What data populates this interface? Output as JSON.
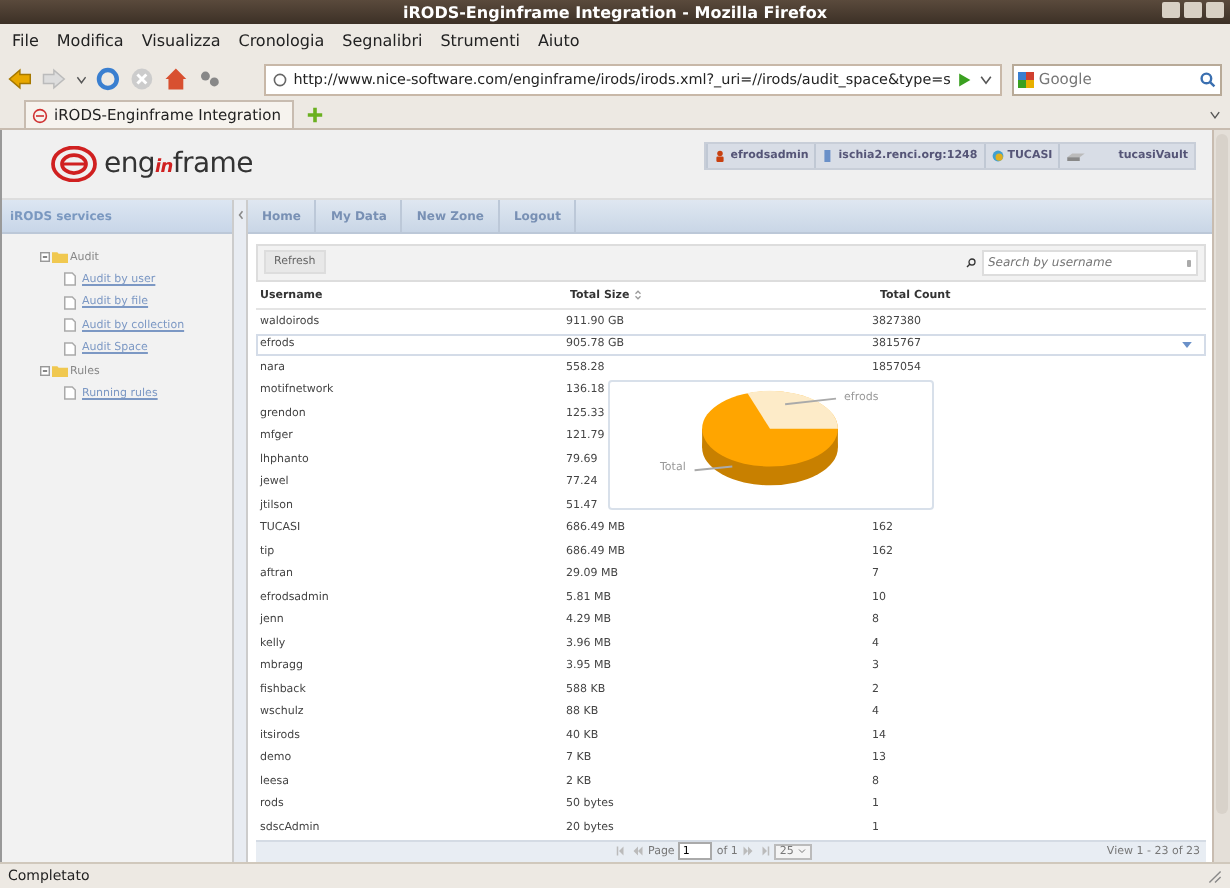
{
  "window": {
    "title": "iRODS-Enginframe Integration - Mozilla Firefox"
  },
  "menu": [
    "File",
    "Modifica",
    "Visualizza",
    "Cronologia",
    "Segnalibri",
    "Strumenti",
    "Aiuto"
  ],
  "address": "http://www.nice-software.com/enginframe/irods/irods.xml?_uri=//irods/audit_space&type=s",
  "search": {
    "placeholder": "Google"
  },
  "browser_tab": {
    "title": "iRODS-Enginframe Integration"
  },
  "logo": {
    "before": "eng",
    "accent": "in",
    "after": "frame"
  },
  "user_badges": [
    {
      "kind": "user",
      "label": "efrodsadmin"
    },
    {
      "kind": "server",
      "label": "ischia2.renci.org:1248"
    },
    {
      "kind": "zone",
      "label": "TUCASI"
    },
    {
      "kind": "vault",
      "label": "tucasiVault"
    }
  ],
  "sidebar": {
    "title": "iRODS services",
    "tree": [
      {
        "label": "Audit",
        "expanded": true,
        "children": [
          {
            "label": "Audit by user"
          },
          {
            "label": "Audit by file"
          },
          {
            "label": "Audit by collection"
          },
          {
            "label": "Audit Space"
          }
        ]
      },
      {
        "label": "Rules",
        "expanded": true,
        "children": [
          {
            "label": "Running rules"
          }
        ]
      }
    ]
  },
  "nav": [
    "Home",
    "My Data",
    "New Zone",
    "Logout"
  ],
  "grid": {
    "refresh": "Refresh",
    "search_placeholder": "Search by username",
    "columns": [
      {
        "label": "Username",
        "sorted": false
      },
      {
        "label": "Total Size",
        "sorted": true
      },
      {
        "label": "Total Count",
        "sorted": false
      }
    ],
    "rows": [
      {
        "username": "waldoirods",
        "size": "911.90 GB",
        "count": "3827380",
        "selected": false
      },
      {
        "username": "efrods",
        "size": "905.78 GB",
        "count": "3815767",
        "selected": true
      },
      {
        "username": "nara",
        "size": "558.28",
        "count": "1857054",
        "selected": false
      },
      {
        "username": "motifnetwork",
        "size": "136.18",
        "selected": false
      },
      {
        "username": "grendon",
        "size": "125.33",
        "selected": false
      },
      {
        "username": "mfger",
        "size": "121.79",
        "selected": false
      },
      {
        "username": "lhphanto",
        "size": "79.69",
        "selected": false
      },
      {
        "username": "jewel",
        "size": "77.24",
        "selected": false
      },
      {
        "username": "jtilson",
        "size": "51.47",
        "selected": false
      },
      {
        "username": "TUCASI",
        "size": "686.49 MB",
        "count": "162",
        "selected": false
      },
      {
        "username": "tip",
        "size": "686.49 MB",
        "count": "162",
        "selected": false
      },
      {
        "username": "aftran",
        "size": "29.09 MB",
        "count": "7",
        "selected": false
      },
      {
        "username": "efrodsadmin",
        "size": "5.81 MB",
        "count": "10",
        "selected": false
      },
      {
        "username": "jenn",
        "size": "4.29 MB",
        "count": "8",
        "selected": false
      },
      {
        "username": "kelly",
        "size": "3.96 MB",
        "count": "4",
        "selected": false
      },
      {
        "username": "mbragg",
        "size": "3.95 MB",
        "count": "3",
        "selected": false
      },
      {
        "username": "fishback",
        "size": "588 KB",
        "count": "2",
        "selected": false
      },
      {
        "username": "wschulz",
        "size": "88 KB",
        "count": "4",
        "selected": false
      },
      {
        "username": "itsirods",
        "size": "40 KB",
        "count": "14",
        "selected": false
      },
      {
        "username": "demo",
        "size": "7 KB",
        "count": "13",
        "selected": false
      },
      {
        "username": "leesa",
        "size": "2 KB",
        "count": "8",
        "selected": false
      },
      {
        "username": "rods",
        "size": "50 bytes",
        "count": "1",
        "selected": false
      },
      {
        "username": "sdscAdmin",
        "size": "20 bytes",
        "count": "1",
        "selected": false
      }
    ],
    "pager": {
      "page_label": "Page",
      "page": "1",
      "of": "of 1",
      "per_page": "25",
      "view": "View 1 - 23 of 23"
    }
  },
  "popup": {
    "labels": [
      "efrods",
      "Total"
    ]
  },
  "status_bar": "Completato"
}
